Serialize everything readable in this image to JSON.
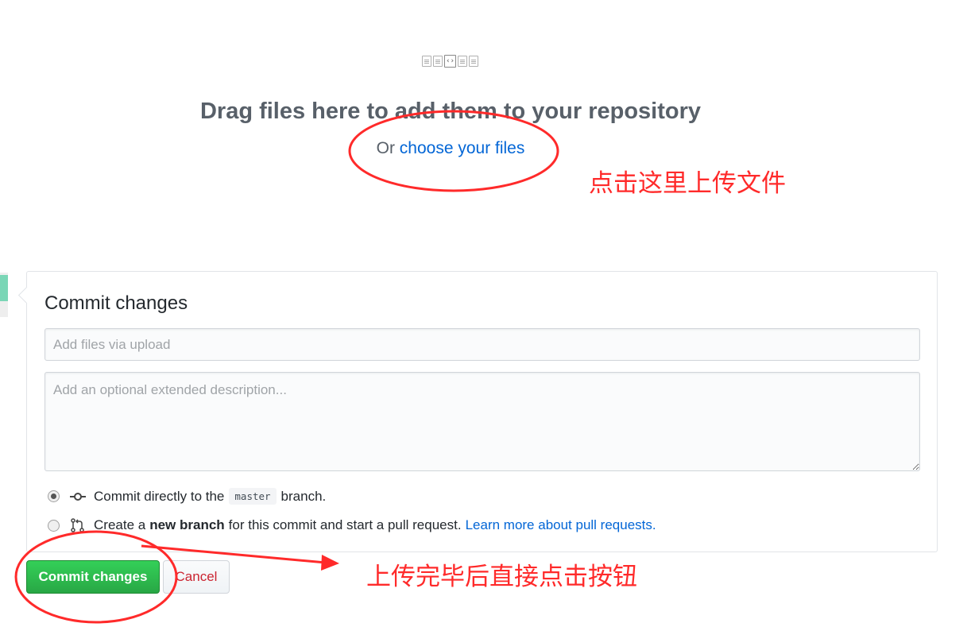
{
  "upload": {
    "title": "Drag files here to add them to your repository",
    "choose_prefix": "Or",
    "choose_link": "choose your files"
  },
  "commit": {
    "heading": "Commit changes",
    "summary_placeholder": "Add files via upload",
    "description_placeholder": "Add an optional extended description...",
    "option_direct": {
      "before": "Commit directly to the",
      "branch": "master",
      "after": "branch."
    },
    "option_new_branch": {
      "before": "Create a",
      "bold": "new branch",
      "after": "for this commit and start a pull request.",
      "link": "Learn more about pull requests."
    },
    "commit_button": "Commit changes",
    "cancel_button": "Cancel"
  },
  "annotations": {
    "upload_hint": "点击这里上传文件",
    "commit_hint": "上传完毕后直接点击按钮",
    "color": "#ff2a2a"
  },
  "colors": {
    "link": "#0366d6",
    "primary_button": "#28a745",
    "cancel_text": "#cb2431"
  }
}
